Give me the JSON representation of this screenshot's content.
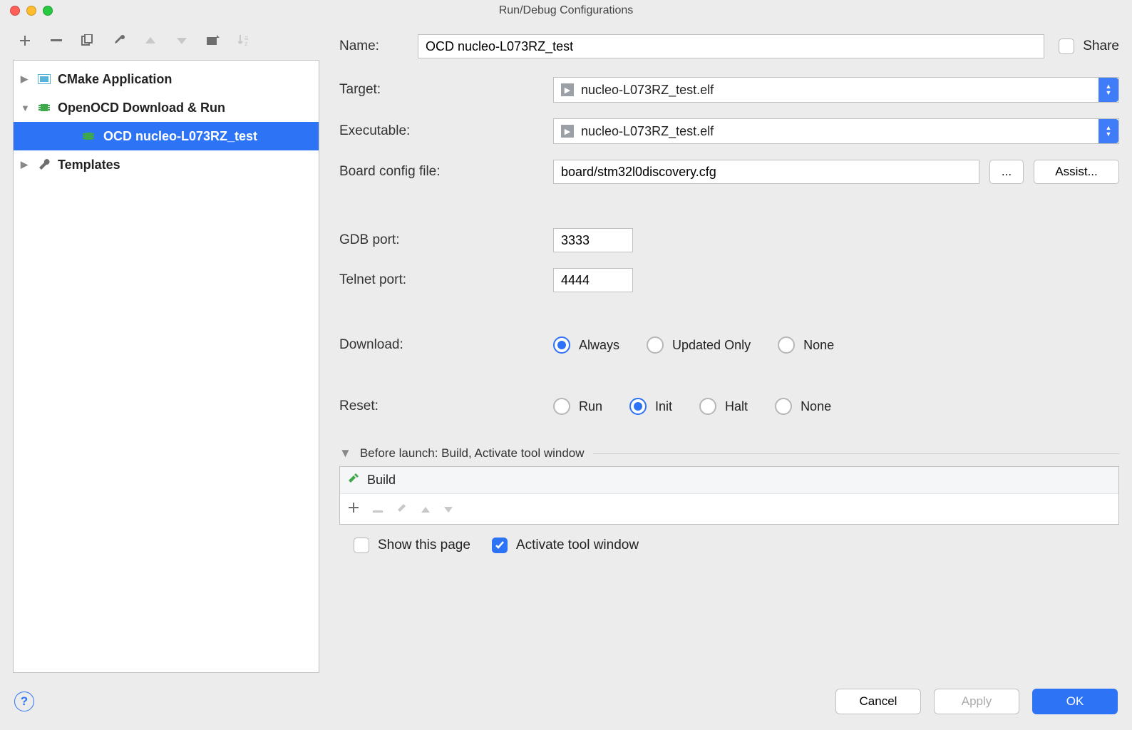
{
  "window": {
    "title": "Run/Debug Configurations"
  },
  "tree": {
    "nodes": [
      {
        "label": "CMake Application"
      },
      {
        "label": "OpenOCD Download & Run",
        "child": "OCD nucleo-L073RZ_test"
      },
      {
        "label": "Templates"
      }
    ]
  },
  "form": {
    "name_label": "Name:",
    "name_value": "OCD nucleo-L073RZ_test",
    "share_label": "Share",
    "target_label": "Target:",
    "target_value": "nucleo-L073RZ_test.elf",
    "executable_label": "Executable:",
    "executable_value": "nucleo-L073RZ_test.elf",
    "board_label": "Board config file:",
    "board_value": "board/stm32l0discovery.cfg",
    "browse_btn": "...",
    "assist_btn": "Assist...",
    "gdb_label": "GDB port:",
    "gdb_value": "3333",
    "telnet_label": "Telnet port:",
    "telnet_value": "4444",
    "download_label": "Download:",
    "download_options": [
      "Always",
      "Updated Only",
      "None"
    ],
    "download_selected": "Always",
    "reset_label": "Reset:",
    "reset_options": [
      "Run",
      "Init",
      "Halt",
      "None"
    ],
    "reset_selected": "Init"
  },
  "before_launch": {
    "header": "Before launch: Build, Activate tool window",
    "item": "Build",
    "show_page_label": "Show this page",
    "activate_label": "Activate tool window"
  },
  "footer": {
    "cancel": "Cancel",
    "apply": "Apply",
    "ok": "OK"
  }
}
